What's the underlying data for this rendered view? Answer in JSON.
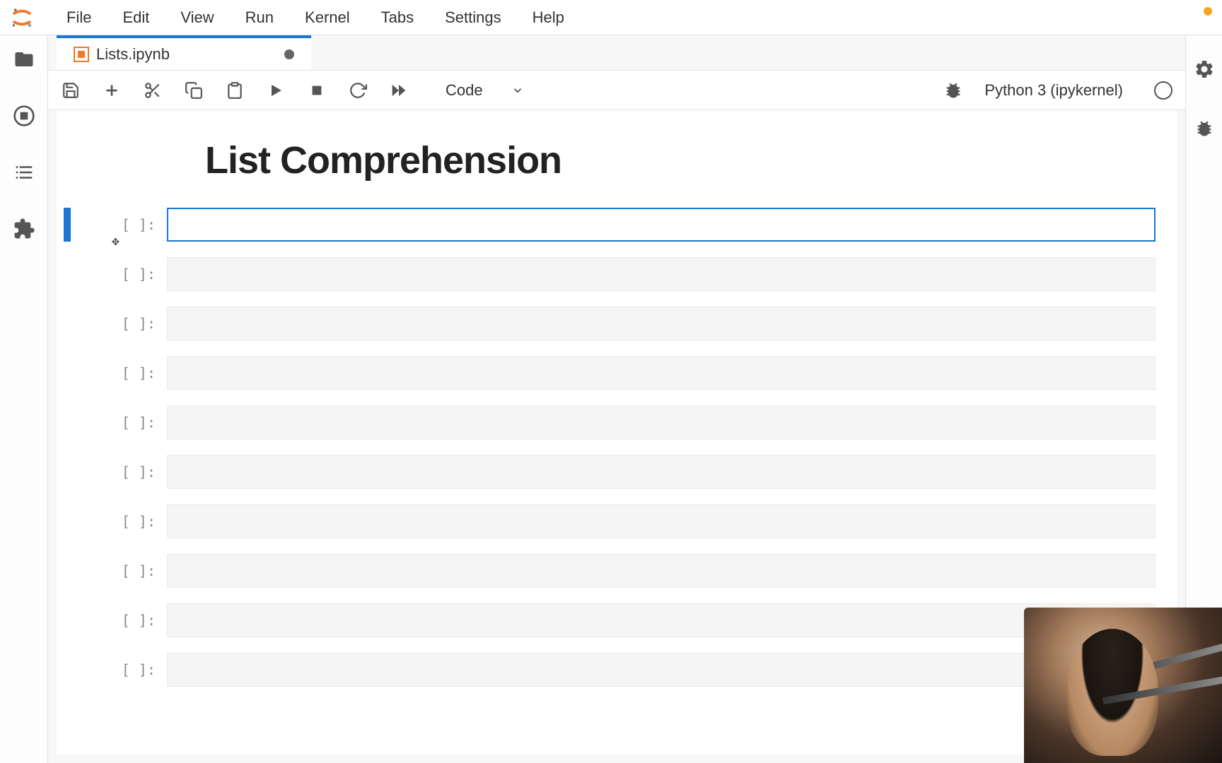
{
  "menu": {
    "items": [
      "File",
      "Edit",
      "View",
      "Run",
      "Kernel",
      "Tabs",
      "Settings",
      "Help"
    ]
  },
  "tab": {
    "title": "Lists.ipynb"
  },
  "toolbar": {
    "cell_type": "Code"
  },
  "kernel": {
    "name": "Python 3 (ipykernel)"
  },
  "notebook": {
    "heading": "List Comprehension",
    "cell_prompt": "[  ]:",
    "cells": [
      {
        "active": true,
        "content": ""
      },
      {
        "active": false,
        "content": ""
      },
      {
        "active": false,
        "content": ""
      },
      {
        "active": false,
        "content": ""
      },
      {
        "active": false,
        "content": ""
      },
      {
        "active": false,
        "content": ""
      },
      {
        "active": false,
        "content": ""
      },
      {
        "active": false,
        "content": ""
      },
      {
        "active": false,
        "content": ""
      },
      {
        "active": false,
        "content": ""
      }
    ]
  }
}
